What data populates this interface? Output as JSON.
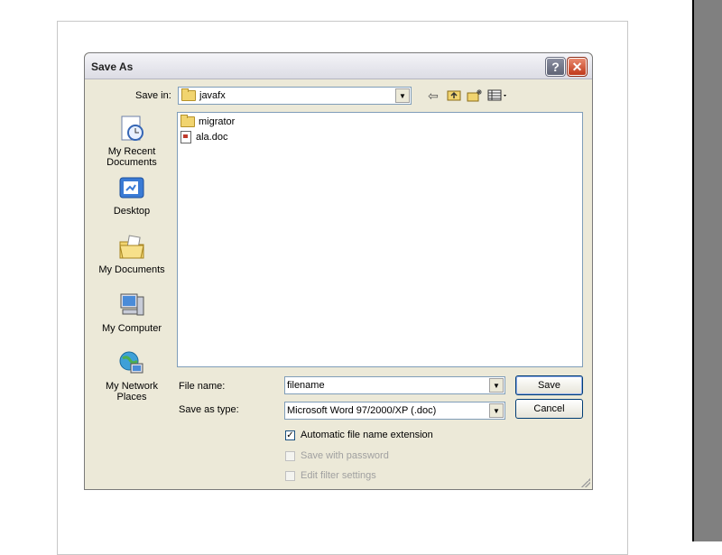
{
  "dialog": {
    "title": "Save As",
    "help_glyph": "?",
    "close_glyph": "✕",
    "save_in_label": "Save in:",
    "save_in_value": "javafx",
    "places": [
      {
        "label_1": "My Recent",
        "label_2": "Documents",
        "icon": "recent-documents-icon"
      },
      {
        "label_1": "Desktop",
        "icon": "desktop-icon"
      },
      {
        "label_1": "My Documents",
        "icon": "my-documents-icon"
      },
      {
        "label_1": "My Computer",
        "icon": "my-computer-icon"
      },
      {
        "label_1": "My Network",
        "label_2": "Places",
        "icon": "network-places-icon"
      }
    ],
    "files": [
      {
        "name": "migrator",
        "icon": "folder-icon"
      },
      {
        "name": "ala.doc",
        "icon": "word-document-icon"
      }
    ],
    "file_name_label": "File name:",
    "file_name_value": "filename",
    "save_as_type_label": "Save as type:",
    "save_as_type_value": "Microsoft Word 97/2000/XP (.doc)",
    "save_button": "Save",
    "cancel_button": "Cancel",
    "options": [
      {
        "label": "Automatic file name extension",
        "checked": true,
        "enabled": true
      },
      {
        "label": "Save with password",
        "checked": false,
        "enabled": false
      },
      {
        "label": "Edit filter settings",
        "checked": false,
        "enabled": false
      }
    ]
  },
  "colors": {
    "dialog_bg": "#ece9d8",
    "close_button": "#c0391b",
    "right_panel": "#808080"
  }
}
